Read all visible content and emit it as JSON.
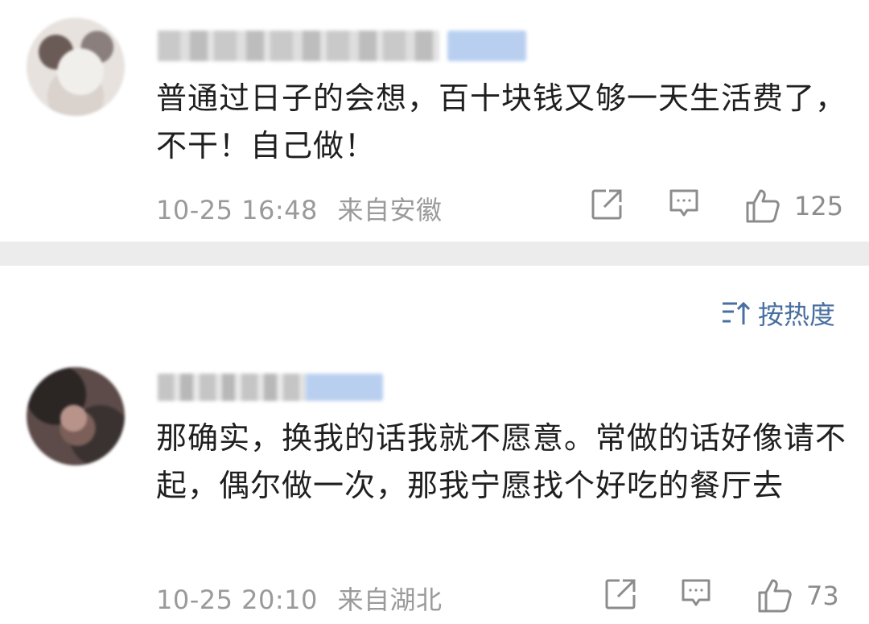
{
  "comments": [
    {
      "text": "普通过日子的会想，百十块钱又够一天生活费了，不干！自己做！",
      "time": "10-25 16:48",
      "location": "来自安徽",
      "likes": "125",
      "share_icon": "share-icon",
      "reply_icon": "comment-icon",
      "like_icon": "thumbs-up-icon"
    },
    {
      "text": "那确实，换我的话我就不愿意。常做的话好像请不起，偶尔做一次，那我宁愿找个好吃的餐厅去",
      "time": "10-25 20:10",
      "location": "来自湖北",
      "likes": "73",
      "share_icon": "share-icon",
      "reply_icon": "comment-icon",
      "like_icon": "thumbs-up-icon"
    }
  ],
  "sort": {
    "label": "按热度",
    "icon": "sort-icon"
  },
  "colors": {
    "meta": "#9a9a9a",
    "sort_link": "#486fa0",
    "divider": "#ececec"
  }
}
